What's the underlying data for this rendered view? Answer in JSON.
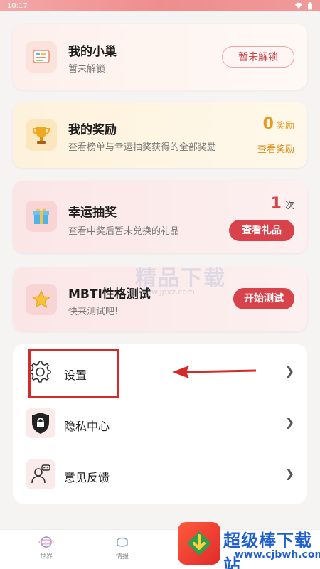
{
  "status_bar": {
    "time": "10:17"
  },
  "cards": {
    "nest": {
      "title": "我的小巢",
      "subtitle": "暂未解锁",
      "button": "暂未解锁",
      "icon": "nest-icon"
    },
    "rewards": {
      "title": "我的奖励",
      "subtitle": "查看榜单与幸运抽奖获得的全部奖励",
      "count": "0",
      "count_unit": "奖励",
      "link": "查看奖励",
      "icon": "trophy-icon"
    },
    "lottery": {
      "title": "幸运抽奖",
      "subtitle": "查看中奖后暂未兑换的礼品",
      "count": "1",
      "count_unit": "次",
      "button": "查看礼品",
      "icon": "gift-icon"
    },
    "mbti": {
      "title": "MBTI性格测试",
      "subtitle": "快来测试吧!",
      "button": "开始测试",
      "icon": "star-icon"
    }
  },
  "menu": [
    {
      "label": "设置",
      "icon": "gear-icon"
    },
    {
      "label": "隐私中心",
      "icon": "shield-lock-icon"
    },
    {
      "label": "意见反馈",
      "icon": "feedback-icon"
    }
  ],
  "tabbar": [
    {
      "label": "世界",
      "icon": "world-icon"
    },
    {
      "label": "情报",
      "icon": "intel-icon"
    }
  ],
  "watermarks": {
    "center_text": "精品下载",
    "center_url": "www.jpxz.com",
    "site_name": "超级棒下载站",
    "site_url": "www.cjbwh.com"
  },
  "colors": {
    "accent_red": "#d7424b",
    "annotation_red": "#d62a2a",
    "reward_orange": "#e69a1e"
  }
}
